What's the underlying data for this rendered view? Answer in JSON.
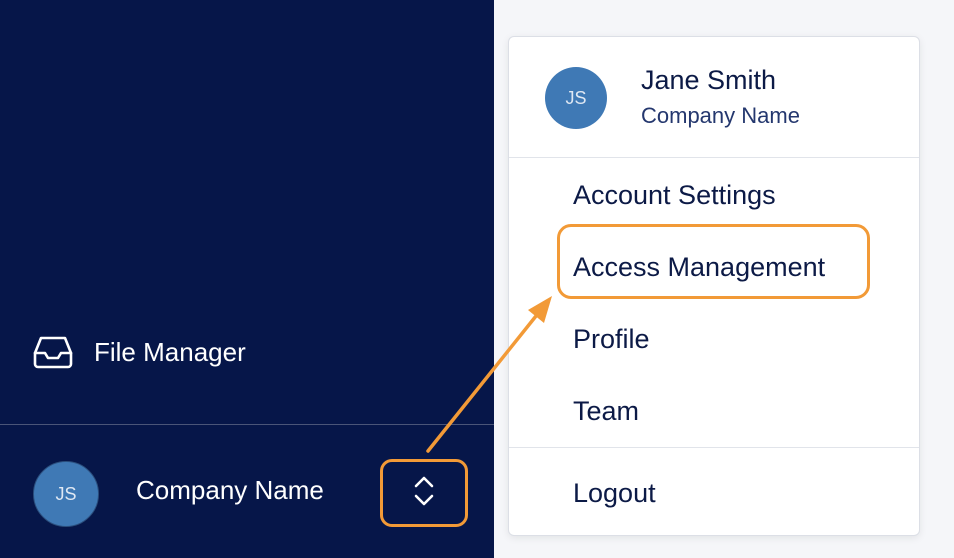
{
  "sidebar": {
    "nav_item_label": "File Manager",
    "account": {
      "initials": "JS",
      "company": "Company Name"
    }
  },
  "menu": {
    "user": {
      "initials": "JS",
      "name": "Jane Smith",
      "company": "Company Name"
    },
    "items": [
      "Account Settings",
      "Access Management",
      "Profile",
      "Team"
    ],
    "logout": "Logout"
  },
  "colors": {
    "sidebar_bg": "#061649",
    "accent": "#f29a37",
    "avatar": "#3f79b5"
  },
  "icons": {
    "nav": "inbox-tray-icon",
    "switcher": "chevron-up-down-icon"
  }
}
